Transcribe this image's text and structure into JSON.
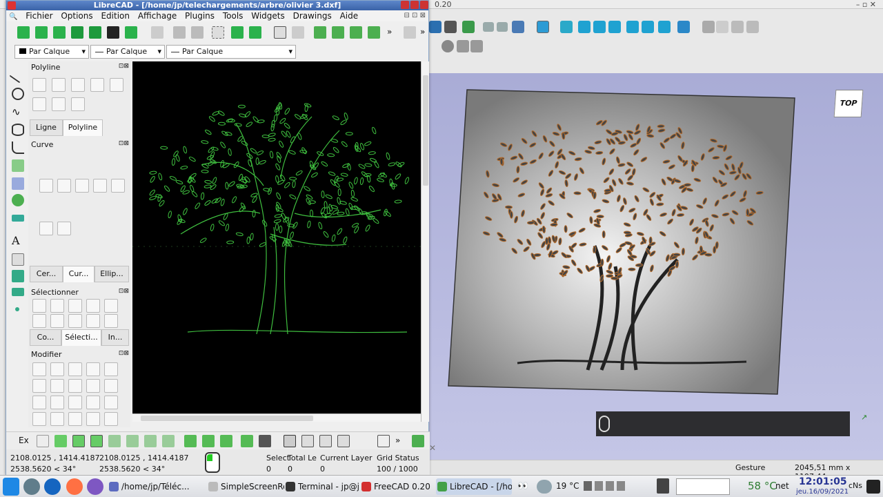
{
  "freecad": {
    "title_fragment": "0.20",
    "status": {
      "nav_style": "Gesture",
      "dimensions": "2045,51 mm x 1197,44 mm"
    },
    "nav_cube_label": "TOP"
  },
  "librecad": {
    "title": "LibreCAD - [/home/jp/telechargements/arbre/olivier 3.dxf]",
    "menu": [
      "Fichier",
      "Options",
      "Edition",
      "Affichage",
      "Plugins",
      "Tools",
      "Widgets",
      "Drawings",
      "Aide"
    ],
    "pen": {
      "color_label": "Par Calque",
      "width_label": "Par Calque",
      "type_label": "Par Calque"
    },
    "docks": {
      "polyline": {
        "title": "Polyline",
        "tabs": [
          "Ligne",
          "Polyline"
        ]
      },
      "curve": {
        "title": "Curve",
        "tabs": [
          "Cer...",
          "Cur...",
          "Ellip..."
        ]
      },
      "select": {
        "title": "Sélectionner",
        "tabs": [
          "Co...",
          "Sélecti...",
          "In..."
        ]
      },
      "modify": {
        "title": "Modifier"
      }
    },
    "snap_label": "Ex",
    "status": {
      "abs_coord": "2108.0125 , 1414.4187",
      "abs_polar": "2538.5620 < 34°",
      "rel_coord": "2108.0125 , 1414.4187",
      "rel_polar": "2538.5620 < 34°",
      "select_label": "Select",
      "select_value": "0",
      "total_label": "Total Le",
      "total_value": "0",
      "layer_label": "Current Layer",
      "layer_value": "0",
      "grid_label": "Grid Status",
      "grid_value": "100 / 1000"
    }
  },
  "taskbar": {
    "tasks": [
      {
        "label": "/home/jp/Téléc..."
      },
      {
        "label": "SimpleScreenRe..."
      },
      {
        "label": "Terminal - jp@jp-..."
      },
      {
        "label": "FreeCAD 0.20"
      },
      {
        "label": "LibreCAD - [/ho..."
      }
    ],
    "weather": "19 °C",
    "cpu_temp": "58 °C",
    "net_label": "net",
    "time": "12:01:05",
    "date": "jeu.16/09/2021",
    "cns": "cNs"
  },
  "colors": {
    "tree_line": "#3fbf3f",
    "canvas_bg": "#000000",
    "title_bar": "#3a63a8",
    "plate": "#8e8e8e"
  }
}
